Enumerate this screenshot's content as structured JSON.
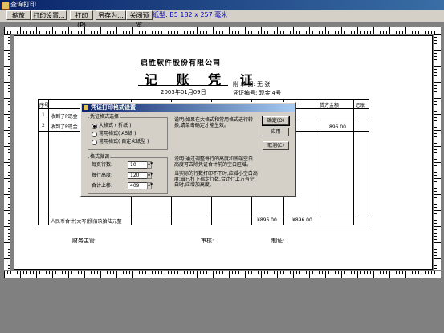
{
  "window": {
    "title": "查询打印"
  },
  "toolbar": {
    "zoom": "缩放",
    "print_setup": "打印设置...",
    "print": "打印(P)",
    "save_as": "另存为...",
    "close_preview": "关闭预览",
    "paper_size": "纸型: B5 182 x 257 毫米"
  },
  "voucher": {
    "company": "启胜软件股份有限公司",
    "title": "记 账 凭 证",
    "date": "2003年01月09日",
    "attachments": "附 单 据:  无 张",
    "number": "凭证编号: 现金 4号",
    "col_seq": "序号",
    "col_amount": "贷方金额",
    "col_mark": "记账",
    "rows": [
      {
        "seq": "1",
        "summary": "收到了P现金",
        "amount": ""
      },
      {
        "seq": "2",
        "summary": "收到了P现金",
        "amount": "896.00"
      }
    ],
    "total_words": "人民币合计(大写)捌佰玖拾陆元整",
    "total_debit": "¥896.00",
    "total_credit": "¥896.00",
    "sign_finance": "财务主管:",
    "sign_audit": "审核:",
    "sign_maker": "制证:"
  },
  "dialog": {
    "title": "凭证打印格式设置",
    "format_group": "凭证格式选择",
    "options": [
      "大格式  (  折纸  )",
      "常用格式( A5纸 )",
      "常用格式( 自定义纸型 )"
    ],
    "selected_option": 0,
    "note1": "说明:如果在大格式和常用格式进行转换,请单击确定才能生效。",
    "fine_group": "格式微调",
    "rows_per_page_label": "每页行数:",
    "rows_per_page": "10",
    "row_height_label": "每行高度:",
    "row_height": "120",
    "total_top_label": "合计上移:",
    "total_top": "409",
    "note2": "说明:通过调整每行的高度和底端空白高度可去除凭证合计前的空白区域。",
    "note3": "当实际的行数打印不下时,应减小空白高度;当已打下指定行数,合计行上方有空白时,应增加高度。",
    "ok": "确定(O)",
    "apply": "应用",
    "cancel": "取消(C)"
  }
}
